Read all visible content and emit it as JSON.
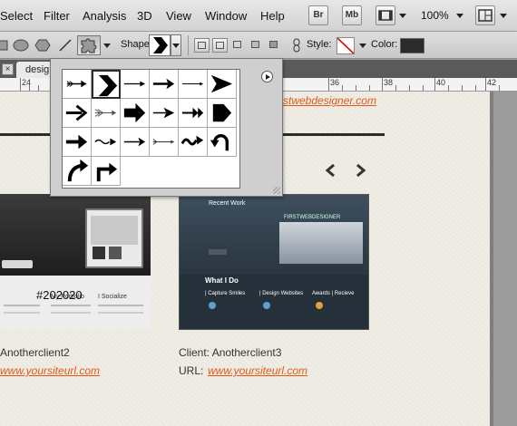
{
  "menubar": {
    "items": [
      "Select",
      "Filter",
      "Analysis",
      "3D",
      "View",
      "Window",
      "Help"
    ],
    "bridge_label": "Br",
    "minibridge_label": "Mb",
    "zoom": "100%"
  },
  "options": {
    "shape_label": "Shape:",
    "style_label": "Style:",
    "color_label": "Color:",
    "color_value": "#2b2b2b"
  },
  "document": {
    "tab_close": "×",
    "tab_title": "desig",
    "ruler_numbers": [
      "24",
      "36",
      "38",
      "40",
      "42"
    ]
  },
  "page": {
    "site_url": "stwebdesigner.com",
    "stray_text": "#202020",
    "clients": [
      {
        "label_prefix": "",
        "client_name": "Anotherclient2",
        "url_prefix": "",
        "url": "www.yoursiteurl.com"
      },
      {
        "label_prefix": "Client:",
        "client_name": "Anotherclient3",
        "url_prefix": "URL:",
        "url": "www.yoursiteurl.com"
      }
    ]
  },
  "thumb2": {
    "heading": "Recent Work",
    "what_i_do": "What I Do",
    "col1": "| Capture Smiles",
    "col2": "| Design Websites",
    "col3": "Awards | Recieve",
    "logo": "FIRSTWEBDESIGNER"
  },
  "thumb1": {
    "line1": "My Portfolio",
    "line2": "I Socialize"
  },
  "shape_picker": {
    "shapes": [
      "arrow-feathered-icon",
      "chevron-icon",
      "arrow-thin-icon",
      "arrow-barbed-icon",
      "arrow-line-icon",
      "arrow-triangle-icon",
      "arrow-bold-icon",
      "arrow-fletched-icon",
      "arrow-block-icon",
      "arrow-swept-icon",
      "arrow-double-head-icon",
      "arrow-pentagon-icon",
      "arrow-thick-icon",
      "arrow-wavy-icon",
      "arrow-tapered-icon",
      "arrow-fletched-thin-icon",
      "arrow-squiggle-icon",
      "arrow-curve-back-icon",
      "arrow-curve-left-icon",
      "arrow-turn-right-icon"
    ]
  }
}
